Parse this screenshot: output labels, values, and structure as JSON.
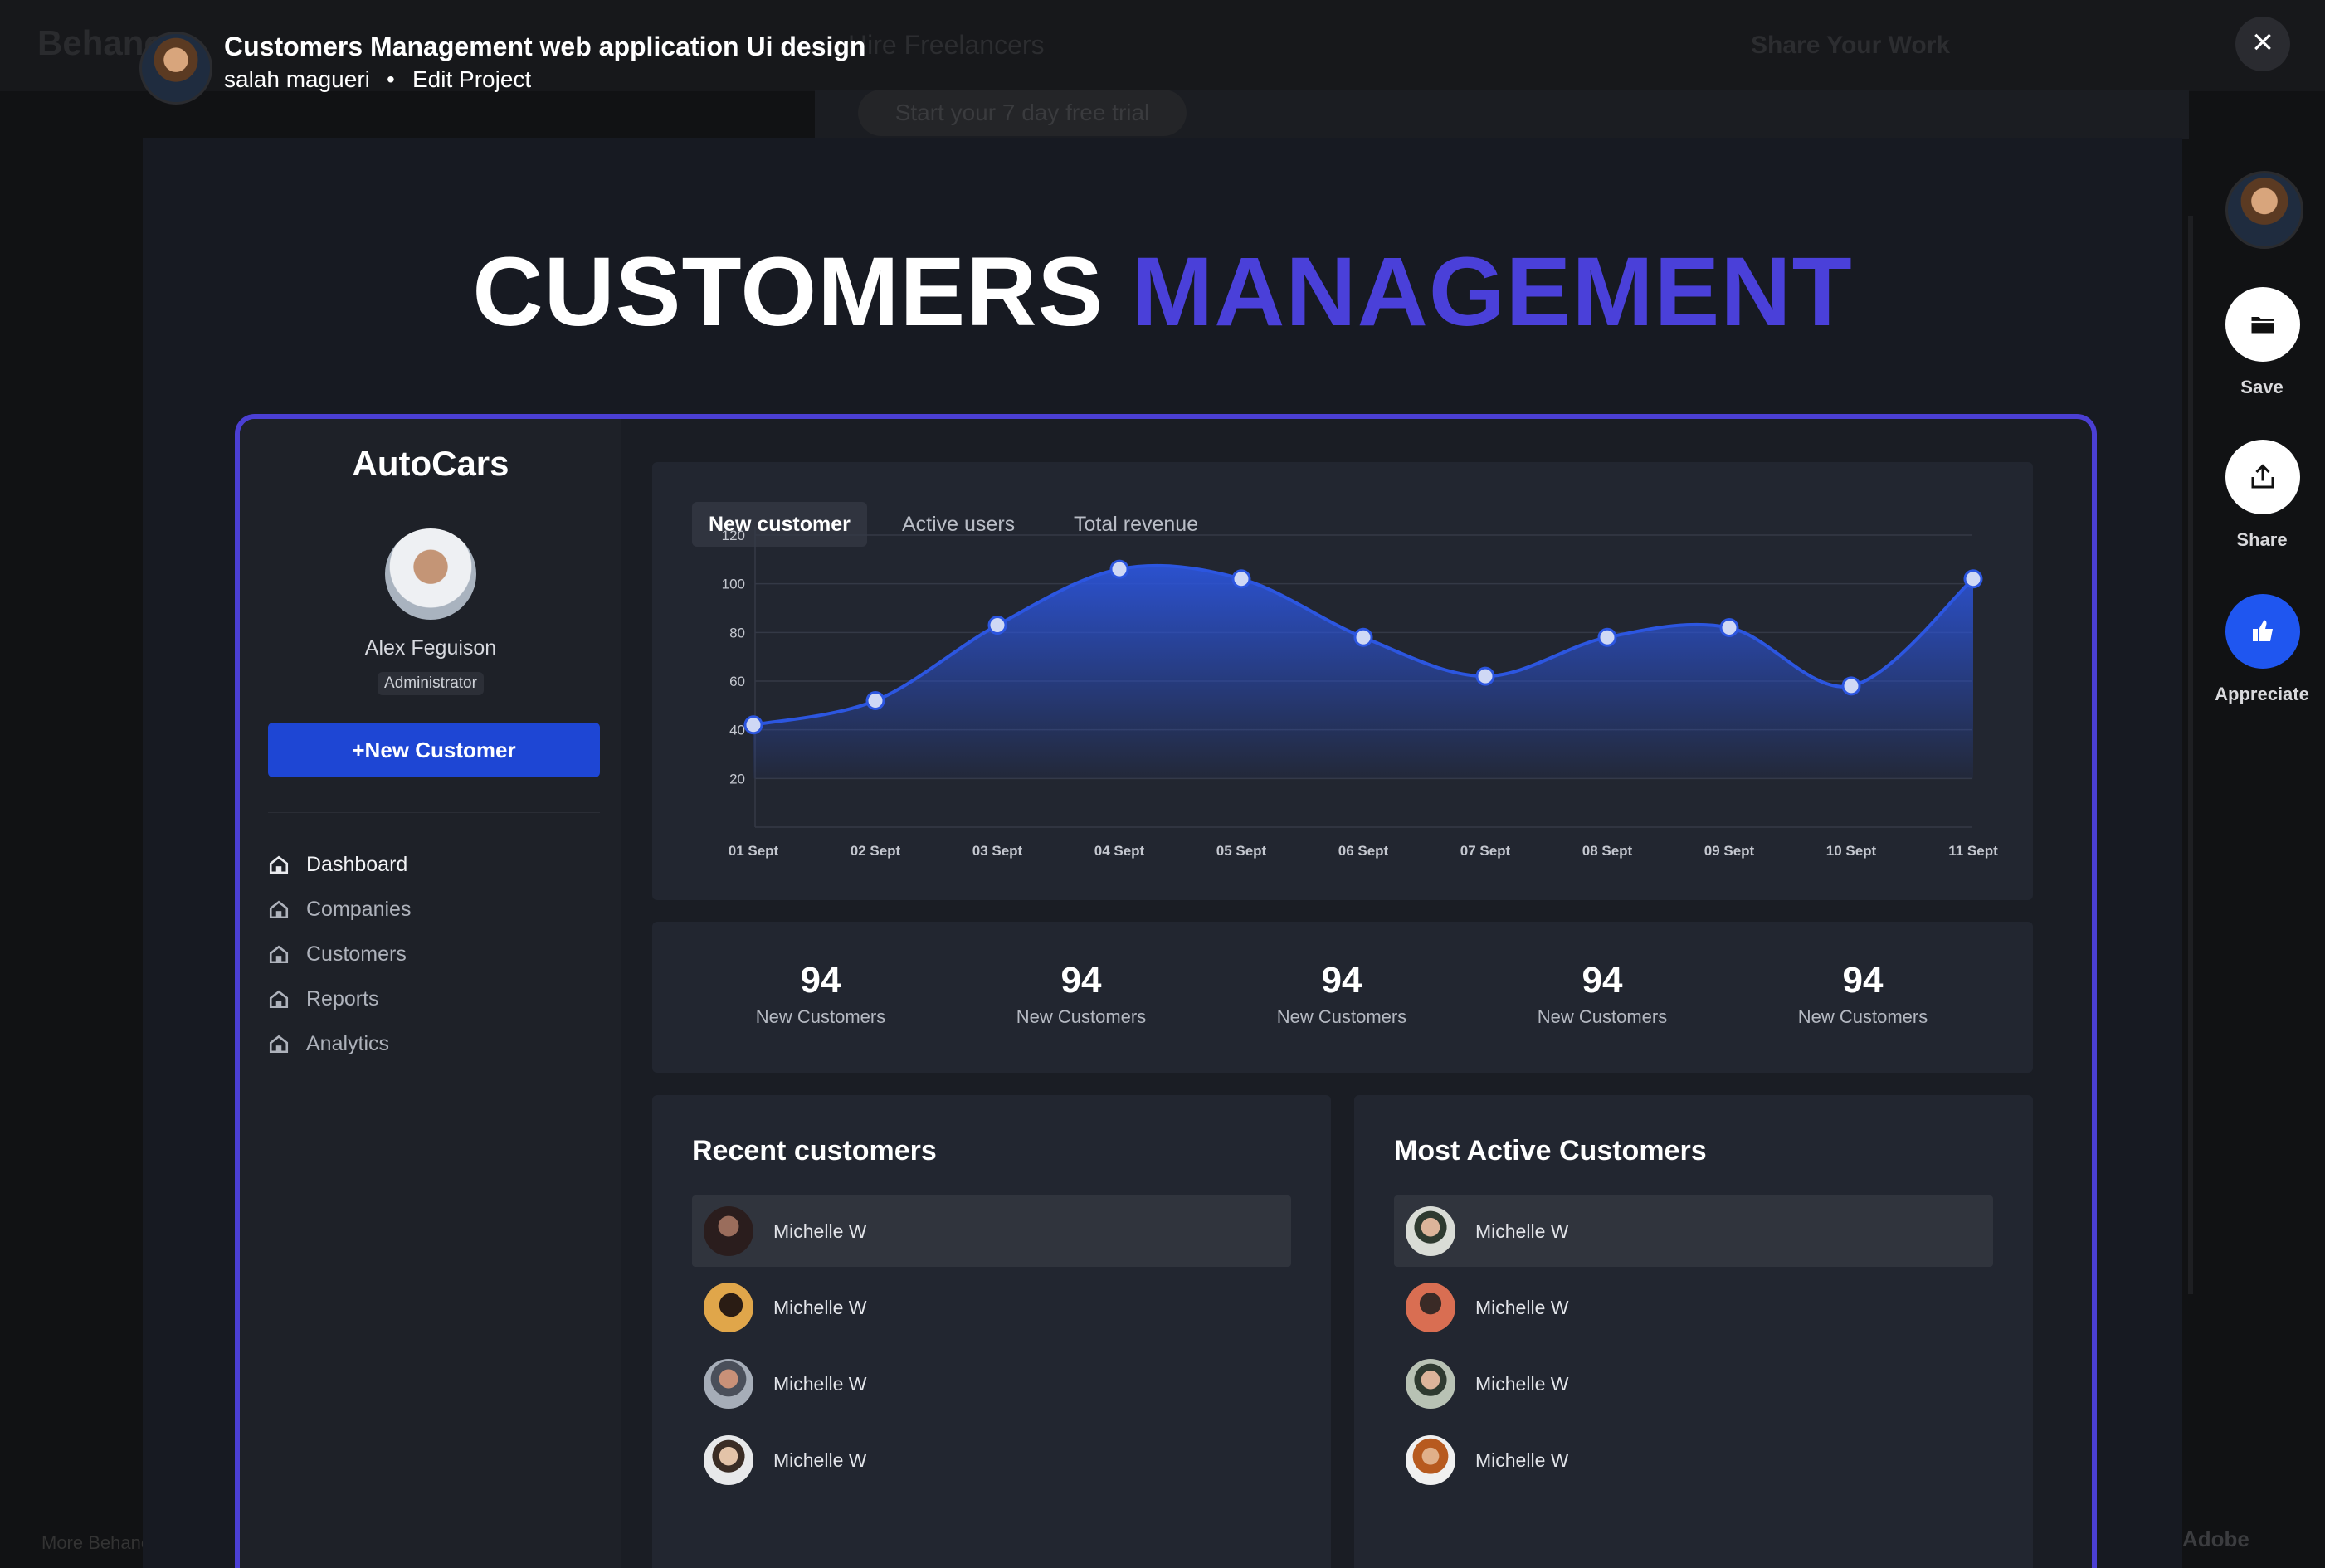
{
  "background": {
    "logo": "Behance",
    "hire": "Hire Freelancers",
    "share_work": "Share Your Work",
    "trial": "Start your 7 day free trial",
    "footer_more": "More Behance",
    "footer_adobe": "Adobe"
  },
  "project": {
    "title": "Customers Management web application Ui design",
    "author": "salah magueri",
    "separator": "•",
    "edit": "Edit Project",
    "close": "×"
  },
  "rail": {
    "save": "Save",
    "share": "Share",
    "appreciate": "Appreciate"
  },
  "hero": {
    "word1": "CUSTOMERS",
    "word2": "MANAGEMENT"
  },
  "colors": {
    "accent": "#4a40d9",
    "primary_button": "#1e46d4",
    "line": "#2c56e0",
    "panel": "#222630"
  },
  "app": {
    "brand": "AutoCars",
    "user": {
      "name": "Alex Feguison",
      "role": "Administrator"
    },
    "new_customer_btn": "+New Customer",
    "nav": [
      {
        "label": "Dashboard",
        "icon": "home-icon"
      },
      {
        "label": "Companies",
        "icon": "home-icon"
      },
      {
        "label": "Customers",
        "icon": "home-icon"
      },
      {
        "label": "Reports",
        "icon": "home-icon"
      },
      {
        "label": "Analytics",
        "icon": "home-icon"
      }
    ],
    "tabs": [
      "New customer",
      "Active users",
      "Total revenue"
    ],
    "stats": [
      {
        "value": "94",
        "label": "New Customers"
      },
      {
        "value": "94",
        "label": "New Customers"
      },
      {
        "value": "94",
        "label": "New Customers"
      },
      {
        "value": "94",
        "label": "New Customers"
      },
      {
        "value": "94",
        "label": "New Customers"
      }
    ],
    "recent": {
      "title": "Recent customers",
      "items": [
        "Michelle W",
        "Michelle W",
        "Michelle W",
        "Michelle W"
      ]
    },
    "active": {
      "title": "Most Active Customers",
      "items": [
        "Michelle W",
        "Michelle W",
        "Michelle W",
        "Michelle W"
      ]
    }
  },
  "chart_data": {
    "type": "area",
    "categories": [
      "01 Sept",
      "02 Sept",
      "03 Sept",
      "04 Sept",
      "05 Sept",
      "06 Sept",
      "07 Sept",
      "08 Sept",
      "09 Sept",
      "10 Sept",
      "11 Sept"
    ],
    "values": [
      42,
      52,
      83,
      106,
      102,
      78,
      62,
      78,
      82,
      58,
      102
    ],
    "yticks": [
      20,
      40,
      60,
      80,
      100,
      120
    ],
    "ylim": [
      0,
      120
    ],
    "grid": true,
    "title": "",
    "xlabel": "",
    "ylabel": ""
  }
}
